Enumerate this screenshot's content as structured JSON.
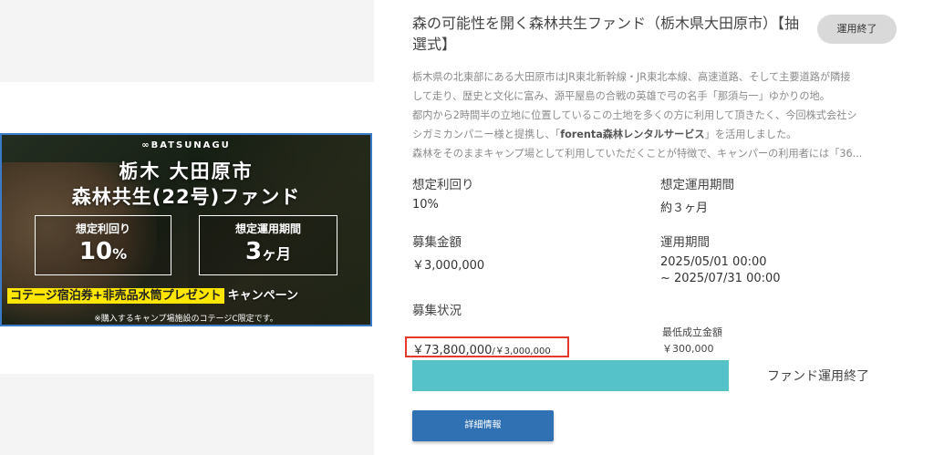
{
  "banner": {
    "logo": "∞BATSUNAGU",
    "title_line1": "栃木 大田原市",
    "title_line2": "森林共生(22号)ファンド",
    "yield_label": "想定利回り",
    "yield_value": "10",
    "yield_unit": "%",
    "period_label": "想定運用期間",
    "period_value": "3",
    "period_unit": "ヶ月",
    "promo_highlight": "コテージ宿泊券+非売品水筒プレゼント",
    "promo_rest": "キャンペーン",
    "note": "※購入するキャンプ場施設のコテージC限定です。"
  },
  "fund": {
    "title": "森の可能性を開く森林共生ファンド（栃木県大田原市）【抽選式】",
    "status_badge": "運用終了",
    "description_lines": {
      "l1": "栃木県の北東部にある大田原市はJR東北新幹線・JR東北本線、高速道路、そして主要道路が隣接",
      "l2": "して走り、歴史と文化に富み、源平屋島の合戦の英雄で弓の名手「那須与一」ゆかりの地。",
      "l3": "都内から2時間半の立地に位置しているこの土地を多くの方に利用して頂きたく、今回株式会社シ",
      "l4_pre": "シガミカンパニー様と提携し、「",
      "l4_bold": "forenta森林レンタルサービス",
      "l4_post": "」を活用しました。",
      "l5": "森林をそのままキャンプ場として利用していただくことが特徴で、キャンパーの利用者には「36..."
    },
    "expected_yield_label": "想定利回り",
    "expected_yield_value": "10%",
    "expected_period_label": "想定運用期間",
    "expected_period_value": "約３ヶ月",
    "target_amount_label": "募集金額",
    "target_amount_value": "￥3,000,000",
    "operation_period_label": "運用期間",
    "operation_period_start": "2025/05/01 00:00",
    "operation_period_end": "~ 2025/07/31 00:00",
    "recruitment_status_label": "募集状況",
    "raised_amount": "￥73,800,000",
    "raised_target": "/￥3,000,000",
    "min_amount_label": "最低成立金額",
    "min_amount_value": "￥300,000",
    "progress_fraction": 1.0,
    "fund_status_text": "ファンド運用終了",
    "detail_button": "詳細情報"
  },
  "colors": {
    "accent_blue": "#2f71b3",
    "progress_teal": "#55c1c9",
    "highlight_red": "#e53a2b",
    "promo_yellow": "#ffe600"
  }
}
